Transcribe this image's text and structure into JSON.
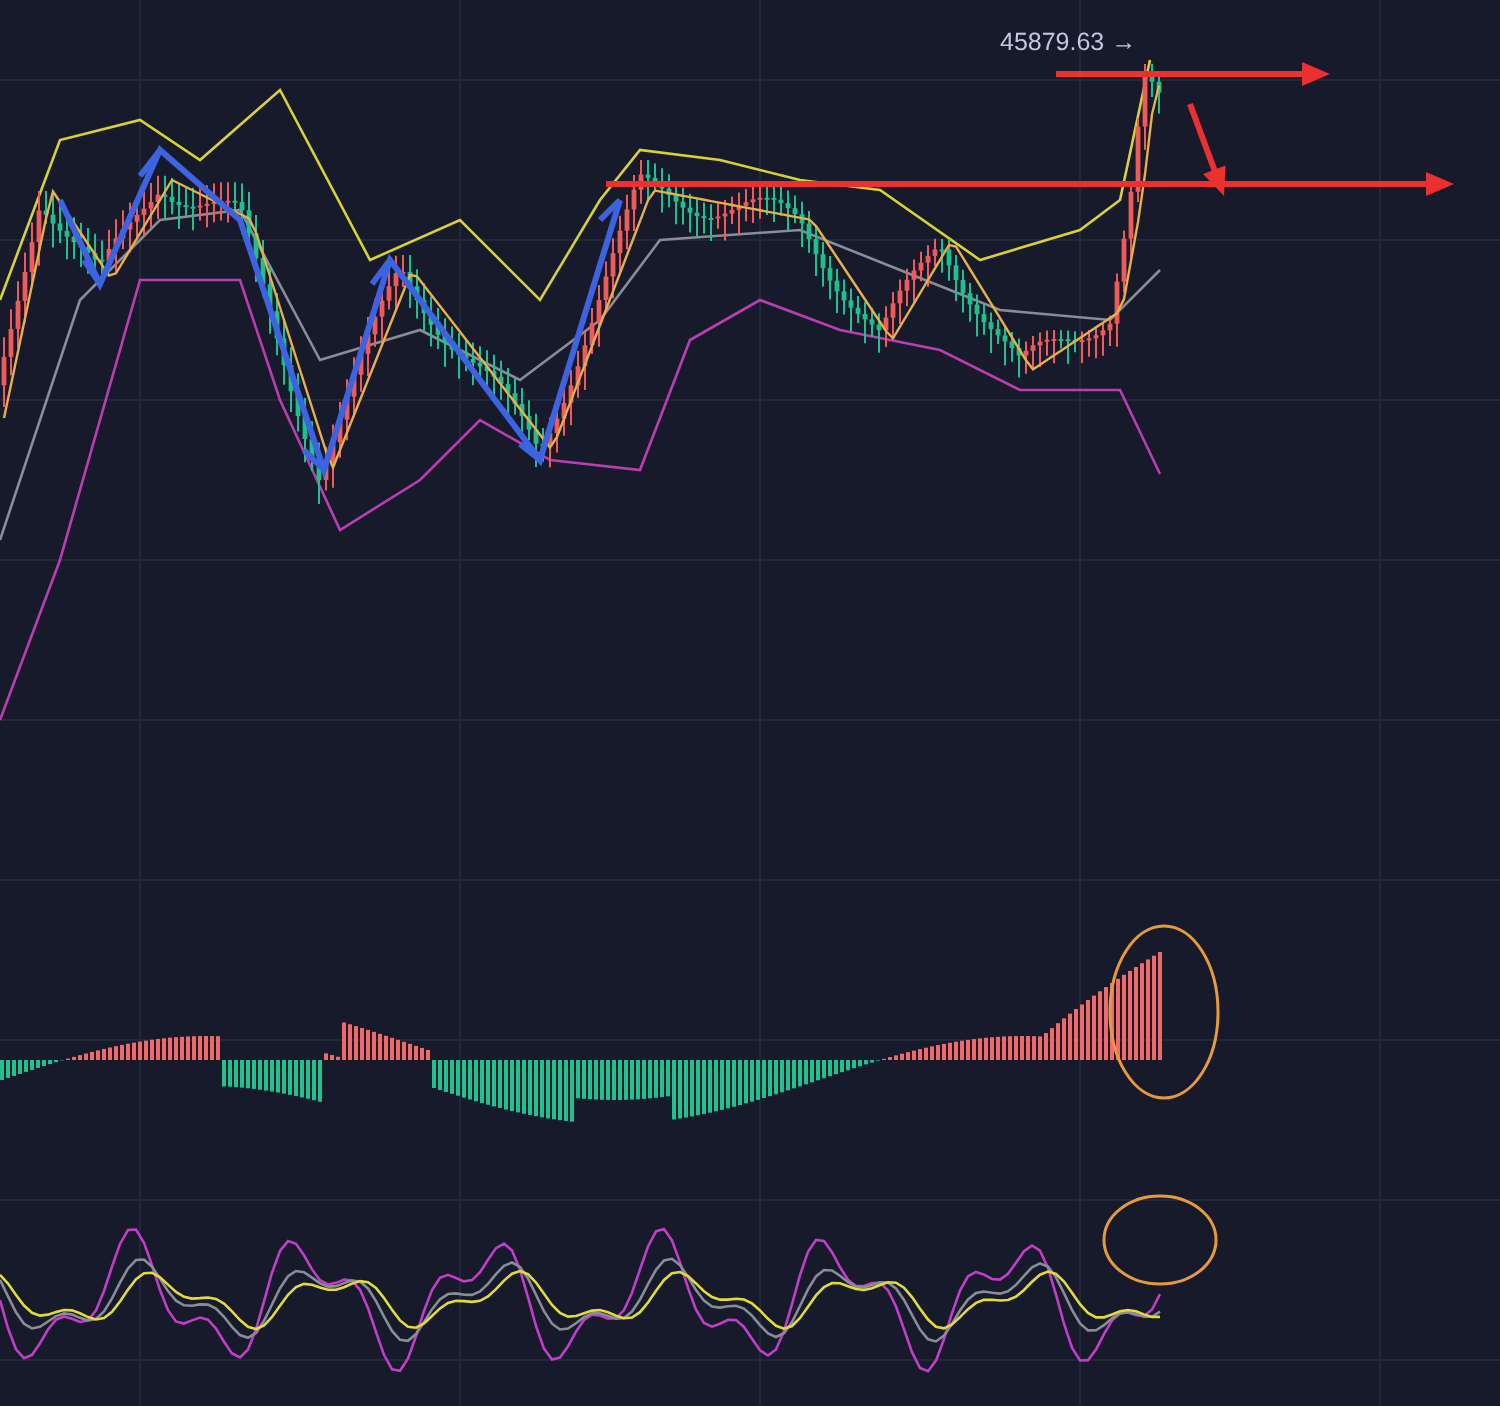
{
  "chart": {
    "last_price_label": "45879.63 →"
  }
}
